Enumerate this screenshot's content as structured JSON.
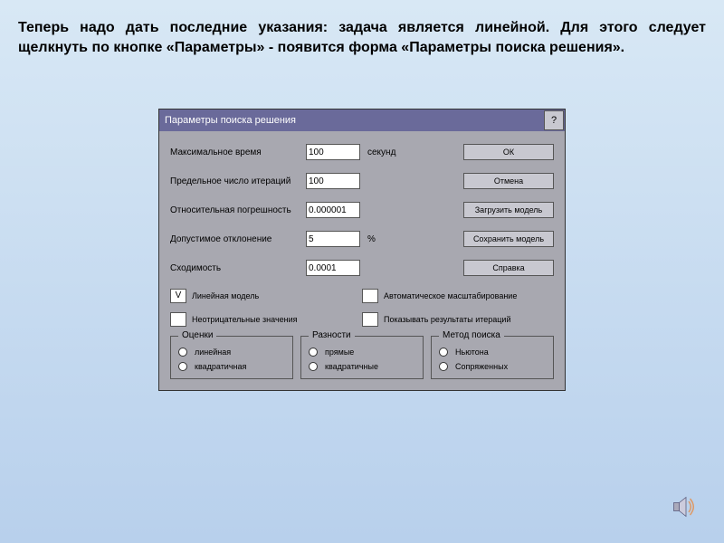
{
  "intro": "Теперь надо дать последние указания: задача является линейной. Для этого следует щелкнуть по кнопке «Параметры» - появится форма  «Параметры поиска решения».",
  "dialog": {
    "title": "Параметры поиска решения",
    "help": "?",
    "rows": {
      "r1": {
        "label": "Максимальное время",
        "value": "100",
        "unit": "секунд"
      },
      "r2": {
        "label": "Предельное число итераций",
        "value": "100",
        "unit": ""
      },
      "r3": {
        "label": "Относительная погрешность",
        "value": "0.000001",
        "unit": ""
      },
      "r4": {
        "label": "Допустимое отклонение",
        "value": "5",
        "unit": "%"
      },
      "r5": {
        "label": "Сходимость",
        "value": "0.0001",
        "unit": ""
      }
    },
    "buttons": {
      "ok": "ОК",
      "cancel": "Отмена",
      "load": "Загрузить модель",
      "save": "Сохранить модель",
      "help": "Справка"
    },
    "checks": {
      "linear": {
        "label": "Линейная модель",
        "mark": "V"
      },
      "nonneg": {
        "label": "Неотрицательные значения",
        "mark": ""
      },
      "autoscale": {
        "label": "Автоматическое масштабирование",
        "mark": ""
      },
      "showiter": {
        "label": "Показывать результаты итераций",
        "mark": ""
      }
    },
    "groups": {
      "g1": {
        "title": "Оценки",
        "opt1": "линейная",
        "opt2": "квадратичная"
      },
      "g2": {
        "title": "Разности",
        "opt1": "прямые",
        "opt2": "квадратичные"
      },
      "g3": {
        "title": "Метод поиска",
        "opt1": "Ньютона",
        "opt2": "Сопряженных"
      }
    }
  }
}
